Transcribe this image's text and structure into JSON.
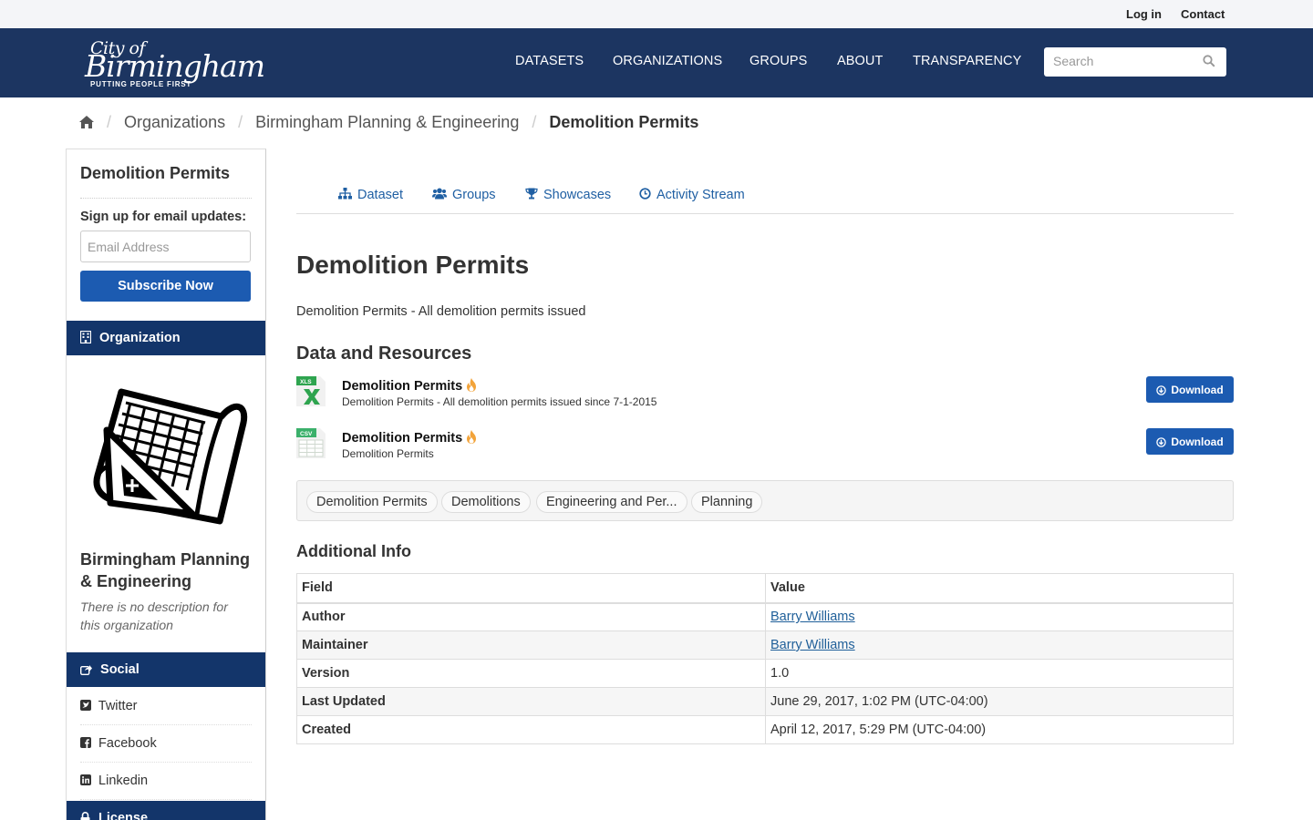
{
  "topbar": {
    "login": "Log in",
    "contact": "Contact"
  },
  "logo": {
    "line1": "City of",
    "line2": "Birmingham",
    "tagline": "PUTTING PEOPLE FIRST"
  },
  "nav": [
    "DATASETS",
    "ORGANIZATIONS",
    "GROUPS",
    "ABOUT",
    "TRANSPARENCY"
  ],
  "search": {
    "placeholder": "Search"
  },
  "breadcrumb": {
    "org": "Organizations",
    "org_name": "Birmingham Planning & Engineering",
    "current": "Demolition Permits"
  },
  "sidebar": {
    "title": "Demolition Permits",
    "signup_label": "Sign up for email updates:",
    "email_placeholder": "Email Address",
    "subscribe_label": "Subscribe Now",
    "organization_heading": "Organization",
    "org_name": "Birmingham Planning & Engineering",
    "org_desc": "There is no description for this organization",
    "social_heading": "Social",
    "social": [
      "Twitter",
      "Facebook",
      "Linkedin"
    ],
    "license_heading": "License"
  },
  "tabs": [
    "Dataset",
    "Groups",
    "Showcases",
    "Activity Stream"
  ],
  "dataset": {
    "title": "Demolition Permits",
    "description": "Demolition Permits - All demolition permits issued"
  },
  "resources_heading": "Data and Resources",
  "resources": [
    {
      "format": "XLS",
      "name": "Demolition Permits",
      "desc": "Demolition Permits - All demolition permits issued since 7-1-2015",
      "button": "Download"
    },
    {
      "format": "CSV",
      "name": "Demolition Permits",
      "desc": "Demolition Permits",
      "button": "Download"
    }
  ],
  "tags": [
    "Demolition Permits",
    "Demolitions",
    "Engineering and Per...",
    "Planning"
  ],
  "additional_heading": "Additional Info",
  "info_table": {
    "headers": [
      "Field",
      "Value"
    ],
    "rows": [
      {
        "field": "Author",
        "value": "Barry Williams"
      },
      {
        "field": "Maintainer",
        "value": "Barry Williams"
      },
      {
        "field": "Version",
        "value": "1.0"
      },
      {
        "field": "Last Updated",
        "value": "June 29, 2017, 1:02 PM (UTC-04:00)"
      },
      {
        "field": "Created",
        "value": "April 12, 2017, 5:29 PM (UTC-04:00)"
      }
    ]
  },
  "colors": {
    "masthead": "#1c3561",
    "sidebar_band": "#13356a",
    "button": "#1c5bb1",
    "link": "#1f5fa3"
  }
}
